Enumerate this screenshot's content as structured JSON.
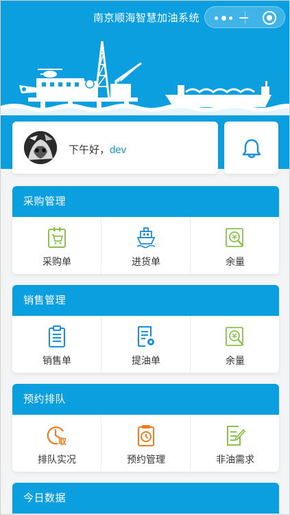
{
  "nav": {
    "title": "南京顺海智慧加油系统"
  },
  "user": {
    "greeting": "下午好，",
    "name": "dev"
  },
  "colors": {
    "brand_blue": "#0b9fe0",
    "name_blue": "#1591d1",
    "icon_green": "#8bc34a",
    "icon_blue": "#1a8fd9",
    "icon_orange": "#f07c1b"
  },
  "sections": [
    {
      "title": "采购管理",
      "items": [
        {
          "label": "采购单",
          "icon": "shopping-cart-icon"
        },
        {
          "label": "进货单",
          "icon": "ship-icon"
        },
        {
          "label": "余量",
          "icon": "balance-search-icon"
        }
      ]
    },
    {
      "title": "销售管理",
      "items": [
        {
          "label": "销售单",
          "icon": "clipboard-icon"
        },
        {
          "label": "提油单",
          "icon": "document-gear-icon"
        },
        {
          "label": "余量",
          "icon": "balance-search-icon"
        }
      ]
    },
    {
      "title": "预约排队",
      "items": [
        {
          "label": "排队实况",
          "icon": "clock-take-icon"
        },
        {
          "label": "预约管理",
          "icon": "timer-board-icon"
        },
        {
          "label": "非油需求",
          "icon": "edit-note-icon"
        }
      ]
    },
    {
      "title": "今日数据",
      "items": []
    }
  ]
}
